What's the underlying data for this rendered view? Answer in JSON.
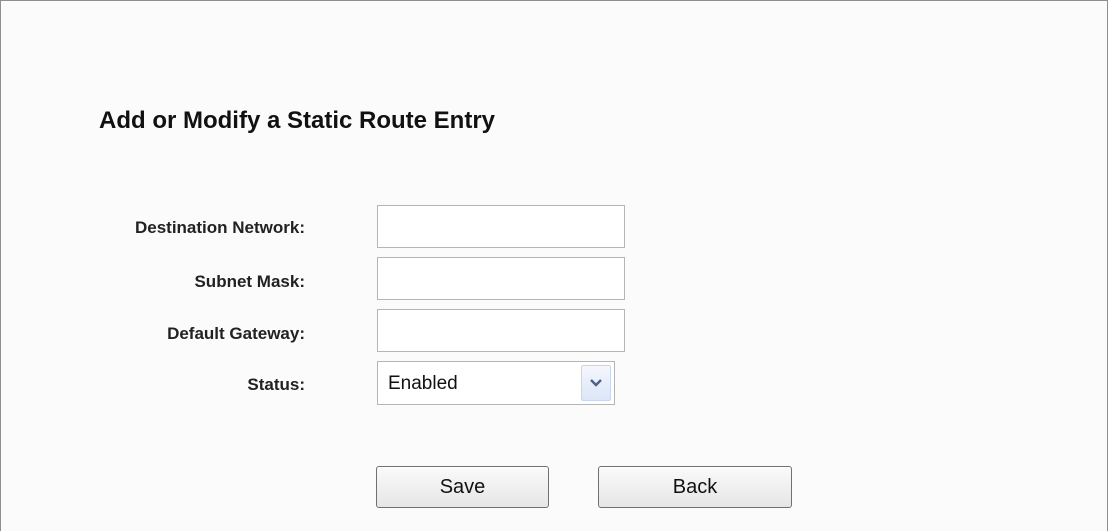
{
  "form": {
    "title": "Add or Modify a Static Route Entry",
    "fields": [
      {
        "label": "Destination Network:",
        "value": ""
      },
      {
        "label": "Subnet Mask:",
        "value": ""
      },
      {
        "label": "Default Gateway:",
        "value": ""
      }
    ],
    "status": {
      "label": "Status:",
      "selected": "Enabled"
    },
    "buttons": {
      "save": "Save",
      "back": "Back"
    }
  }
}
